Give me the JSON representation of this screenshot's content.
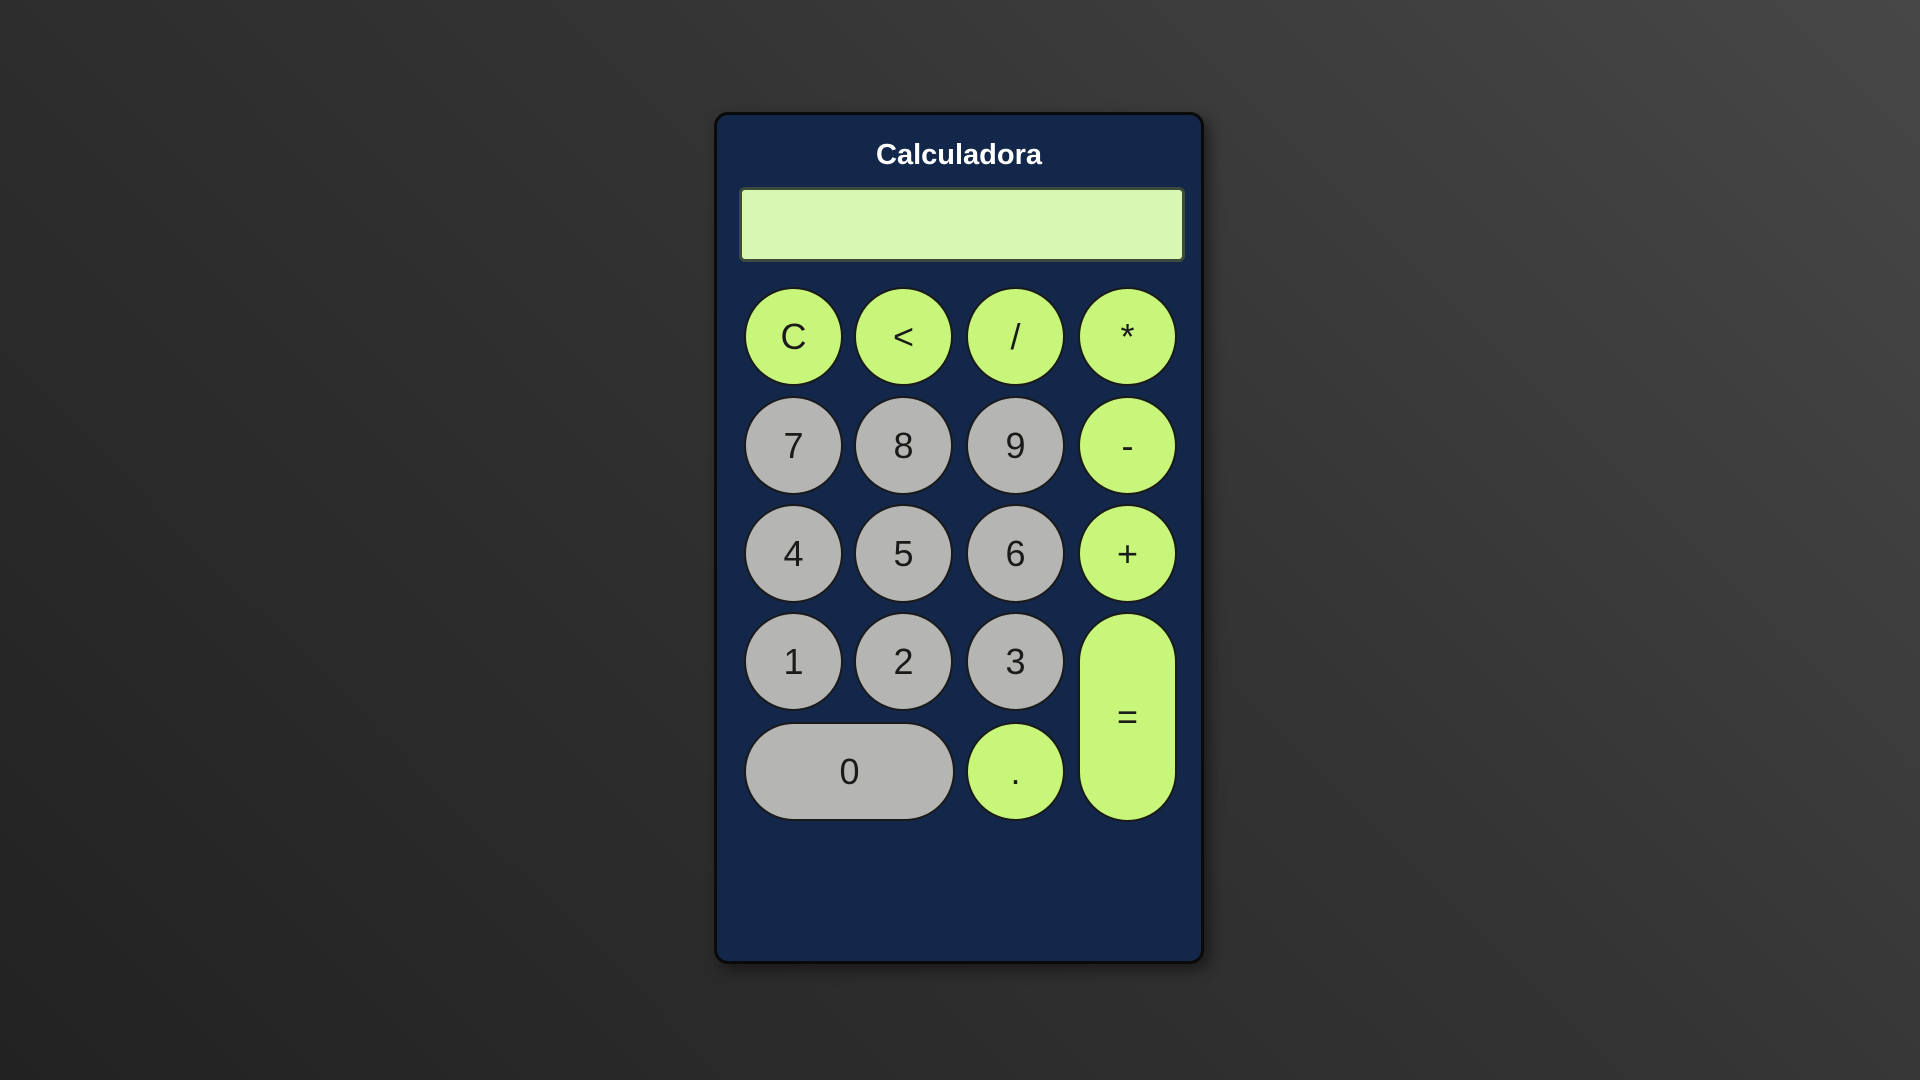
{
  "app": {
    "title": "Calculadora"
  },
  "display": {
    "value": ""
  },
  "buttons": {
    "clear": "C",
    "backspace": "<",
    "divide": "/",
    "multiply": "*",
    "seven": "7",
    "eight": "8",
    "nine": "9",
    "minus": "-",
    "four": "4",
    "five": "5",
    "six": "6",
    "plus": "+",
    "one": "1",
    "two": "2",
    "three": "3",
    "equals": "=",
    "zero": "0",
    "decimal": "."
  },
  "colors": {
    "body": "#13274a",
    "display": "#d8f7b2",
    "operator": "#c7f67a",
    "number": "#b5b5b3"
  }
}
